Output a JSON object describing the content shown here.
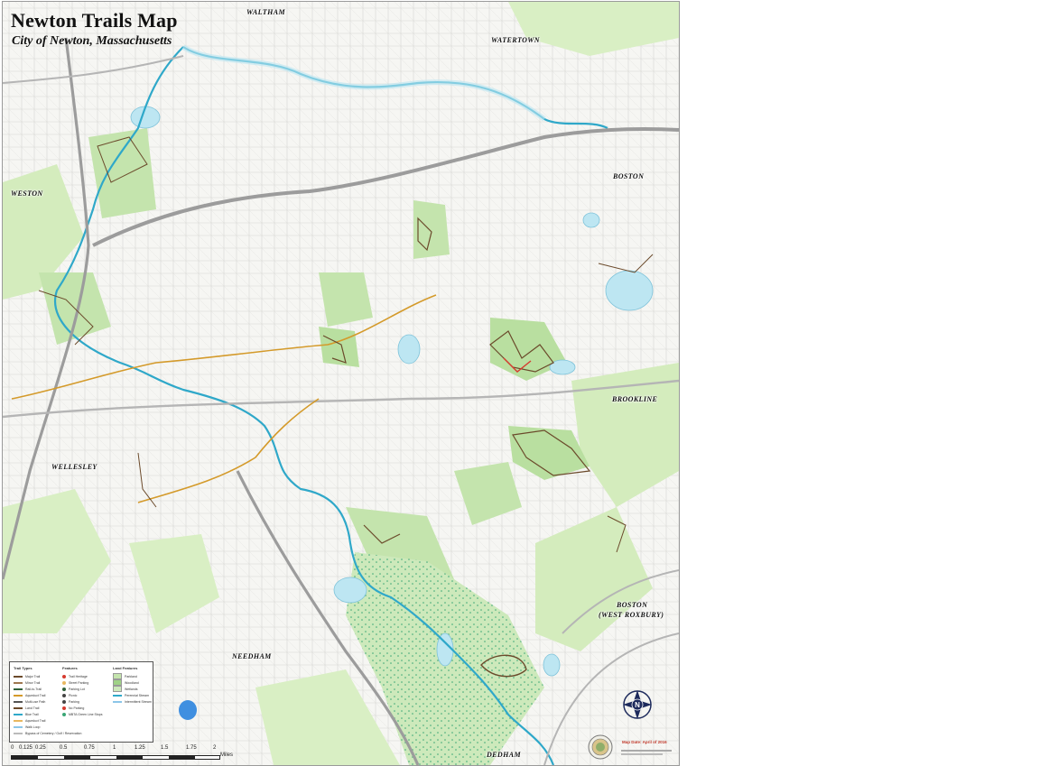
{
  "map": {
    "title": "Newton Trails Map",
    "subtitle": "City of Newton, Massachusetts"
  },
  "towns": {
    "waltham": "WALTHAM",
    "watertown": "WATERTOWN",
    "weston": "WESTON",
    "boston_north": "BOSTON",
    "brookline": "BROOKLINE",
    "wellesley": "WELLESLEY",
    "needham": "NEEDHAM",
    "boston_west_roxbury_1": "BOSTON",
    "boston_west_roxbury_2": "(WEST ROXBURY)",
    "dedham": "DEDHAM"
  },
  "legend": {
    "col1_title": "Trail Types",
    "col1_items": [
      "Major Trail",
      "Minor Trail",
      "Rail-to-Trail",
      "Aqueduct Trail",
      "Multi-use Path",
      "Land Trail",
      "Blue Trail",
      "Aqueduct Trail",
      "Walk Loop",
      "Bypass of Cemetery / Golf / Reservation"
    ],
    "col2_title": "Features",
    "col2_items": [
      "Trail Heritage",
      "Street Parking",
      "Parking Lot",
      "Picnic",
      "Parking",
      "No Parking",
      "MBTA Green Line Stops"
    ],
    "col3_title": "Land Features",
    "col3_items": [
      "Parkland",
      "Woodland",
      "Wetlands",
      "Perennial Stream",
      "Intermittent Stream"
    ]
  },
  "scale": {
    "labels": [
      "0",
      "0.125",
      "0.25",
      "0.5",
      "0.75",
      "1",
      "1.25",
      "1.5",
      "1.75",
      "2"
    ],
    "unit": "Miles"
  },
  "compass": {
    "letter": "N"
  },
  "map_date": "Map Date: April of 2016",
  "colors": {
    "background": "#f6f6f3",
    "park": "#cfe8b5",
    "water": "#bde6f2",
    "river": "#2fa8c9",
    "highway": "#9c9c9c",
    "trail": "#6b4a2b",
    "rail_trail": "#d49a2a",
    "wetland_dots": "#3aa675",
    "compass": "#1d2a5c"
  }
}
